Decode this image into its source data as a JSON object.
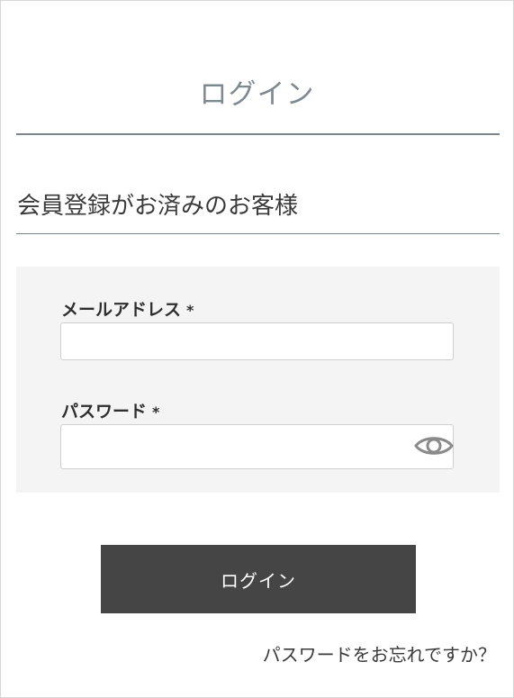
{
  "page": {
    "title": "ログイン"
  },
  "section": {
    "heading": "会員登録がお済みのお客様"
  },
  "form": {
    "email": {
      "label": "メールアドレス",
      "required_mark": "*",
      "value": "",
      "placeholder": ""
    },
    "password": {
      "label": "パスワード",
      "required_mark": "*",
      "value": "",
      "placeholder": "",
      "toggle_icon": "eye-icon"
    }
  },
  "actions": {
    "login_label": "ログイン",
    "forgot_password_label": "パスワードをお忘れですか？"
  },
  "colors": {
    "title": "#7e8a90",
    "rule": "#7d8487",
    "panel_bg": "#f4f4f4",
    "button_bg": "#454545",
    "button_text": "#ffffff",
    "icon": "#8a8a8a"
  }
}
